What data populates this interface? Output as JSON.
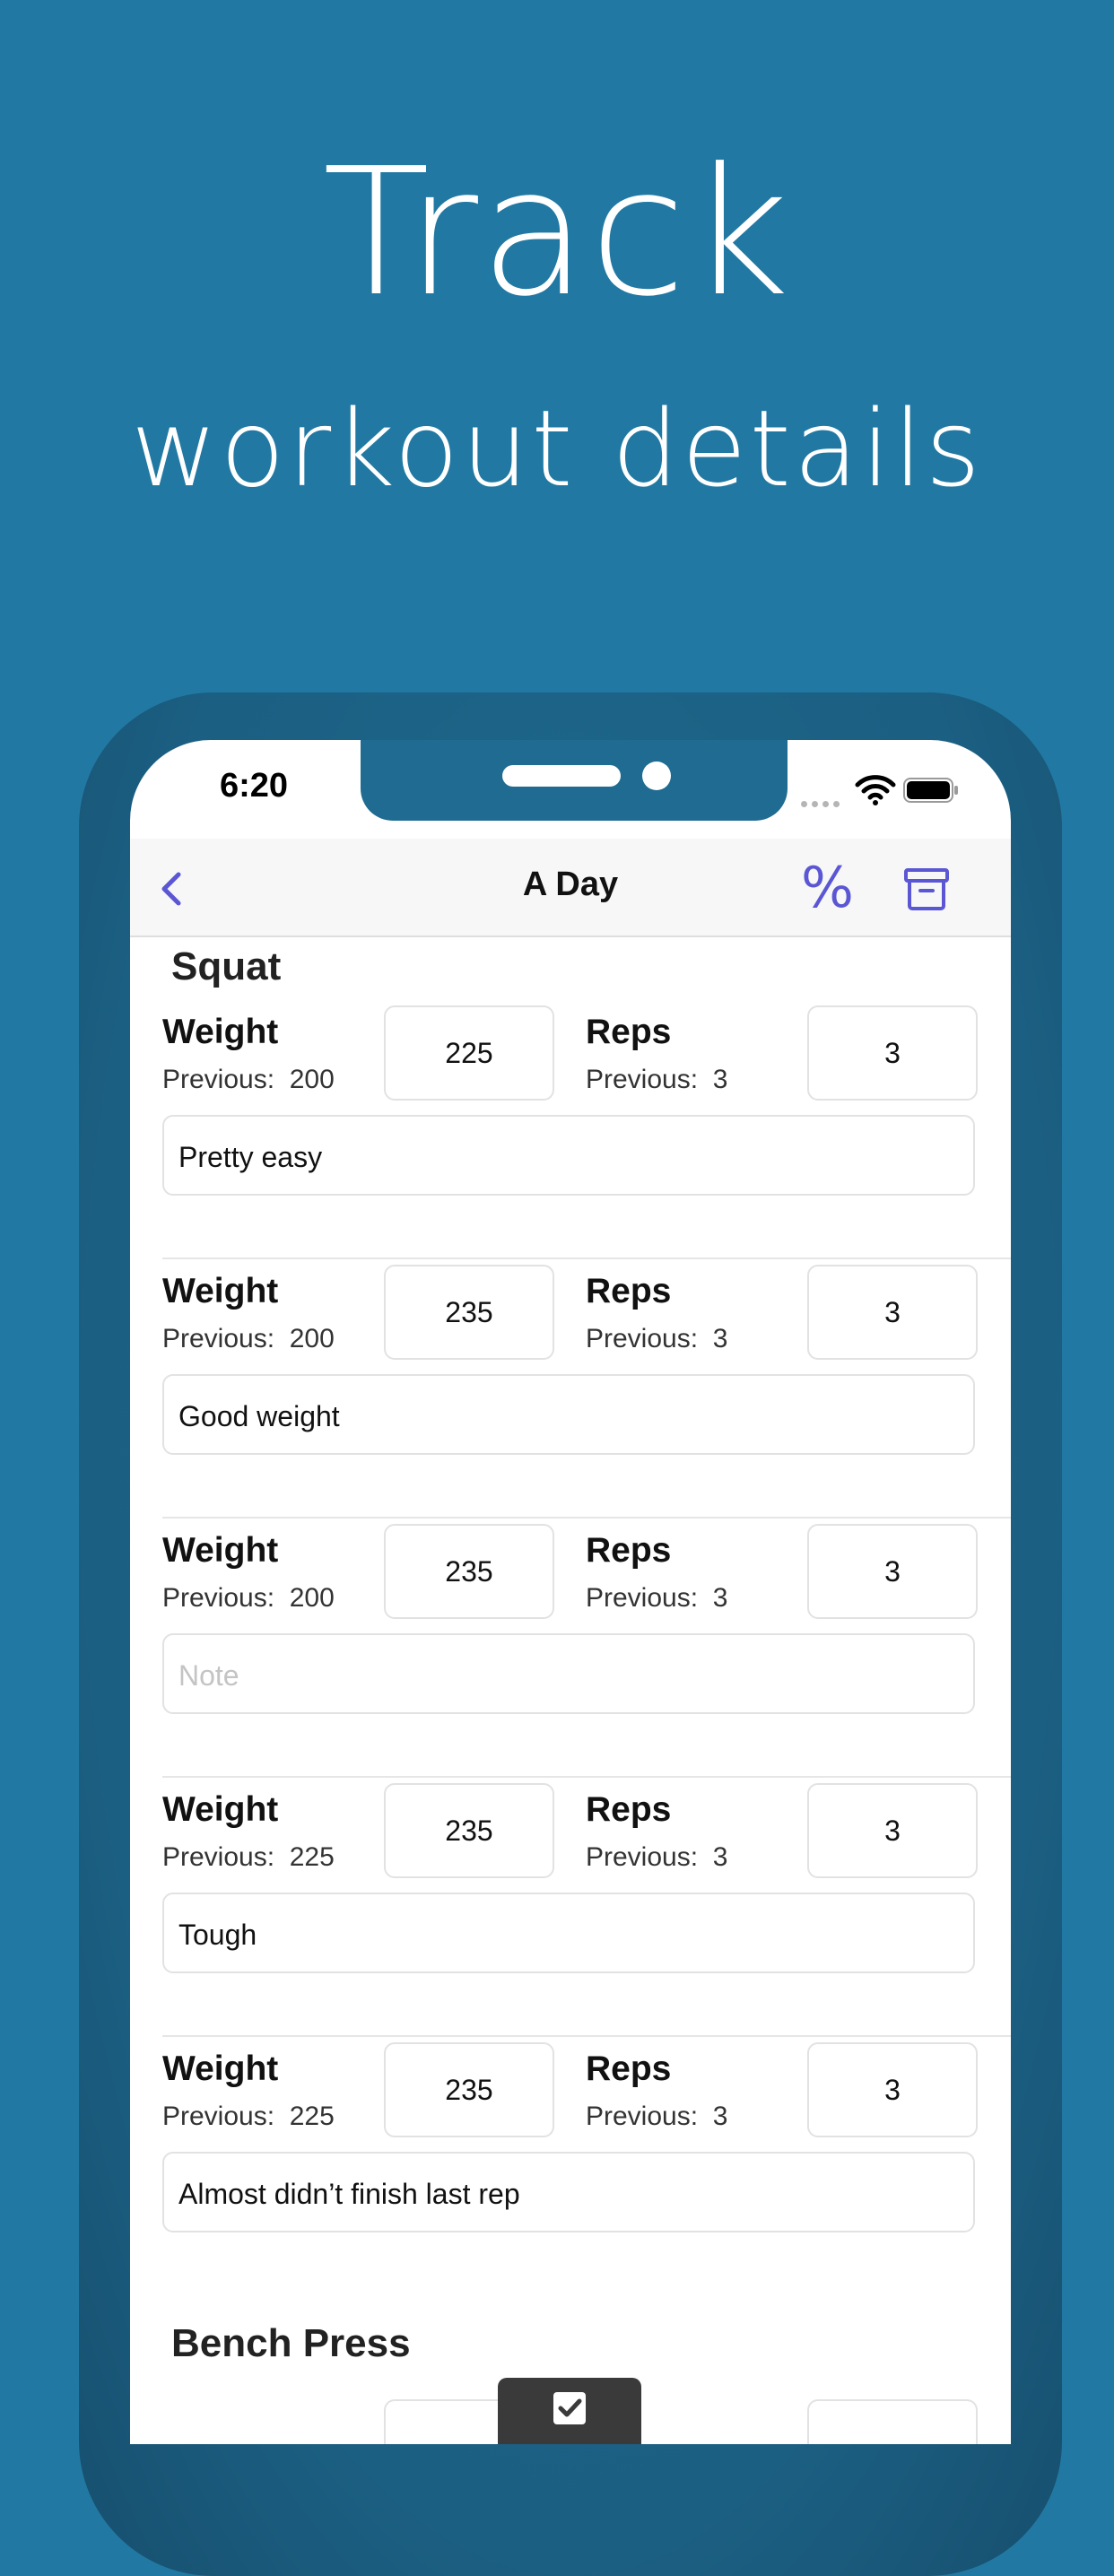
{
  "hero": {
    "title": "Track",
    "subtitle": "workout details"
  },
  "status_bar": {
    "time": "6:20"
  },
  "nav": {
    "title": "A Day",
    "percent_symbol": "%"
  },
  "exercises": [
    {
      "name": "Squat",
      "weight_label": "Weight",
      "reps_label": "Reps",
      "previous_label": "Previous:",
      "sets": [
        {
          "weight": "225",
          "reps": "3",
          "prev_weight": "200",
          "prev_reps": "3",
          "note": "Pretty easy"
        },
        {
          "weight": "235",
          "reps": "3",
          "prev_weight": "200",
          "prev_reps": "3",
          "note": "Good weight"
        },
        {
          "weight": "235",
          "reps": "3",
          "prev_weight": "200",
          "prev_reps": "3",
          "note": "",
          "note_placeholder": "Note"
        },
        {
          "weight": "235",
          "reps": "3",
          "prev_weight": "225",
          "prev_reps": "3",
          "note": "Tough"
        },
        {
          "weight": "235",
          "reps": "3",
          "prev_weight": "225",
          "prev_reps": "3",
          "note": "Almost didn’t finish last rep"
        }
      ]
    },
    {
      "name": "Bench Press"
    }
  ],
  "colors": {
    "background": "#2179a3",
    "accent": "#5b57d4",
    "frame": "#1b5f82"
  },
  "icons": [
    "back-chevron-icon",
    "percent-icon",
    "archive-icon",
    "wifi-icon",
    "battery-icon",
    "checklist-icon"
  ]
}
